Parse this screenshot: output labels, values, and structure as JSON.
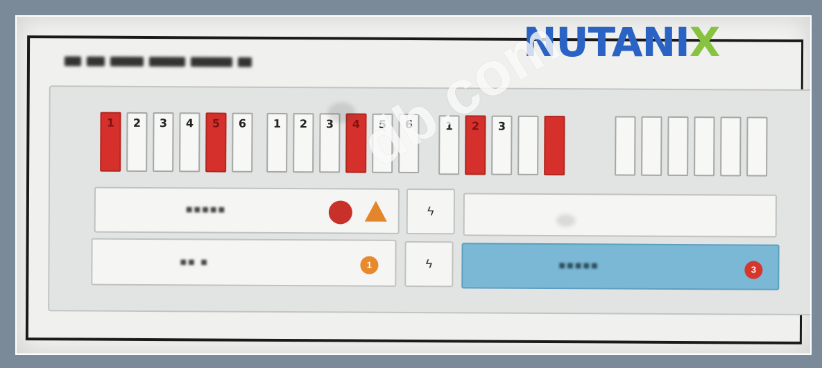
{
  "brand": {
    "logo_main": "NUTANI",
    "logo_x": "X"
  },
  "watermark": "db.com",
  "page": {
    "title_blurred": ""
  },
  "disk_slots": {
    "group1": [
      {
        "num": "1",
        "failed": true
      },
      {
        "num": "2",
        "failed": false
      },
      {
        "num": "3",
        "failed": false
      },
      {
        "num": "4",
        "failed": false
      },
      {
        "num": "5",
        "failed": true
      },
      {
        "num": "6",
        "failed": false
      }
    ],
    "group2": [
      {
        "num": "1",
        "failed": false
      },
      {
        "num": "2",
        "failed": false
      },
      {
        "num": "3",
        "failed": false
      },
      {
        "num": "4",
        "failed": true
      },
      {
        "num": "5",
        "failed": false
      },
      {
        "num": "6",
        "failed": false
      }
    ],
    "group3": [
      {
        "num": "1",
        "failed": false
      },
      {
        "num": "2",
        "failed": true
      },
      {
        "num": "3",
        "failed": false
      },
      {
        "num": "",
        "failed": false
      },
      {
        "num": "",
        "failed": true
      }
    ],
    "group4": [
      {
        "num": ""
      },
      {
        "num": ""
      },
      {
        "num": ""
      },
      {
        "num": ""
      },
      {
        "num": ""
      },
      {
        "num": ""
      }
    ]
  },
  "nodes": [
    {
      "label": "",
      "alert": "red-orange"
    },
    {
      "label": "",
      "alert": "none"
    },
    {
      "label": "",
      "badge": "1",
      "badge_color": "#e78a2d"
    },
    {
      "label": "",
      "badge": "3",
      "badge_color": "#d6372c",
      "selected": true
    }
  ],
  "power_icons": [
    "bolt-icon",
    "bolt-icon"
  ],
  "colors": {
    "failed": "#d5302b",
    "selected_node": "#7ab8d6",
    "warning": "#e78a2d",
    "critical": "#d6372c"
  }
}
